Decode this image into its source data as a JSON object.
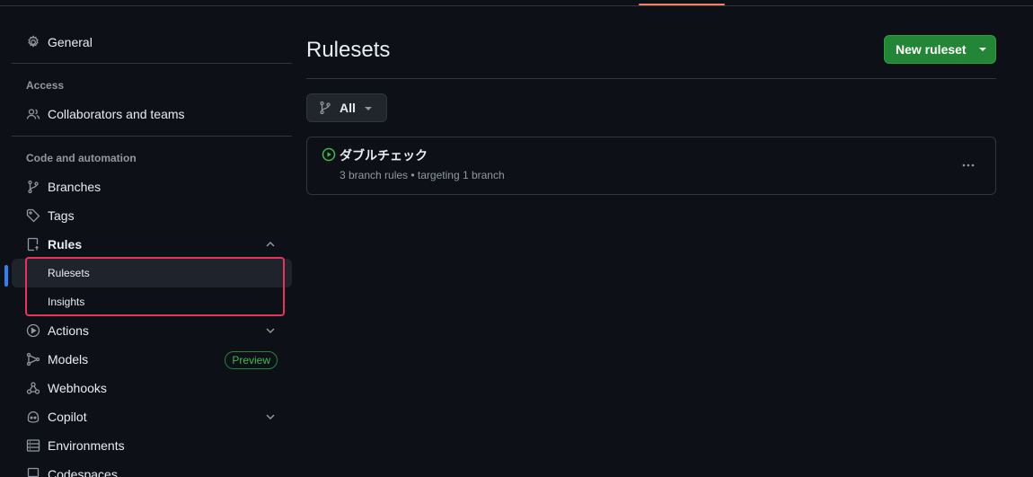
{
  "sidebar": {
    "general": "General",
    "access_heading": "Access",
    "collaborators": "Collaborators and teams",
    "code_heading": "Code and automation",
    "branches": "Branches",
    "tags": "Tags",
    "rules": "Rules",
    "rulesets": "Rulesets",
    "insights": "Insights",
    "actions": "Actions",
    "models": "Models",
    "models_badge": "Preview",
    "webhooks": "Webhooks",
    "copilot": "Copilot",
    "environments": "Environments",
    "codespaces": "Codespaces"
  },
  "main": {
    "title": "Rulesets",
    "new_button": "New ruleset",
    "filter_label": "All",
    "rulesets": [
      {
        "name": "ダブルチェック",
        "meta": "3 branch rules • targeting 1 branch",
        "status": "active"
      }
    ]
  },
  "colors": {
    "accent": "#2f81f7",
    "primary_button": "#238636",
    "highlight": "#e8335a",
    "active_status": "#3fb950"
  }
}
